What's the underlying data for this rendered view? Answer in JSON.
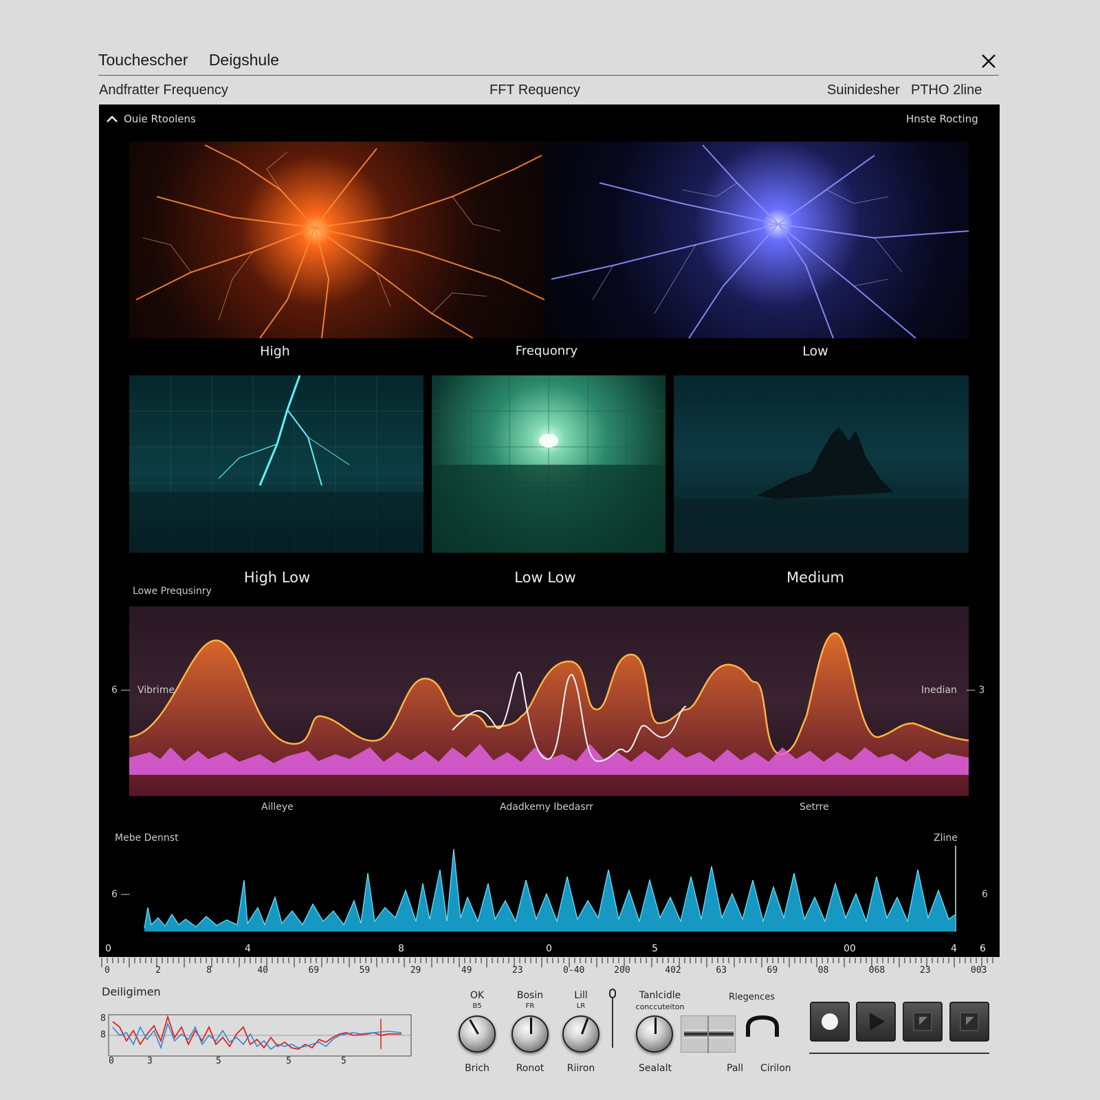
{
  "window": {
    "title_left": "Touchescher",
    "title_right": "Deigshule",
    "sub_left": "Andfratter Frequency",
    "sub_center": "FFT Requency",
    "sub_right_a": "Suinidesher",
    "sub_right_b": "PTHO 2line"
  },
  "panel": {
    "collapse_label": "Ouie Rtoolens",
    "top_right_label": "Hnste Rocting"
  },
  "row1": {
    "labels": [
      "High",
      "Frequonry",
      "Low"
    ]
  },
  "row2": {
    "labels": [
      "High Low",
      "Low Low",
      "Medium"
    ],
    "section_label": "Lowe Prequsinry"
  },
  "spectrum": {
    "left_tick": "6",
    "left_label": "Vibrime",
    "right_label": "Inedian",
    "right_tick": "3",
    "bottom_labels": [
      "Ailleye",
      "Adadkemy Ibedasrr",
      "Setrre"
    ]
  },
  "waveform": {
    "left_label": "Mebe Dennst",
    "right_label": "Zline",
    "left_tick": "6",
    "right_tick": "6",
    "axis_labels": [
      "0",
      "4",
      "8",
      "0",
      "5",
      "00",
      "4",
      "6"
    ]
  },
  "ruler": {
    "labels": [
      "0",
      "2",
      "8",
      "40",
      "69",
      "59",
      "29",
      "49",
      "23",
      "0-40",
      "200",
      "402",
      "63",
      "69",
      "08",
      "068",
      "23",
      "003"
    ]
  },
  "bottom": {
    "mini_chart_title": "Deiligimen",
    "mini_y": [
      "8",
      "8"
    ],
    "mini_x": [
      "0",
      "3",
      "5",
      "5",
      "5"
    ],
    "knobs": [
      {
        "top": "OK",
        "sub": "B5",
        "bottom": "Brich"
      },
      {
        "top": "Bosin",
        "sub": "FR",
        "bottom": "Ronot"
      },
      {
        "top": "Lill",
        "sub": "LR",
        "bottom": "Riiron"
      },
      {
        "top": "Tanlcidle",
        "sub": "conccuteiton",
        "bottom": "Sealalt"
      }
    ],
    "freq_label": "Rlegences",
    "part_label": "Pall",
    "cutoff_label": "Cirilon"
  }
}
